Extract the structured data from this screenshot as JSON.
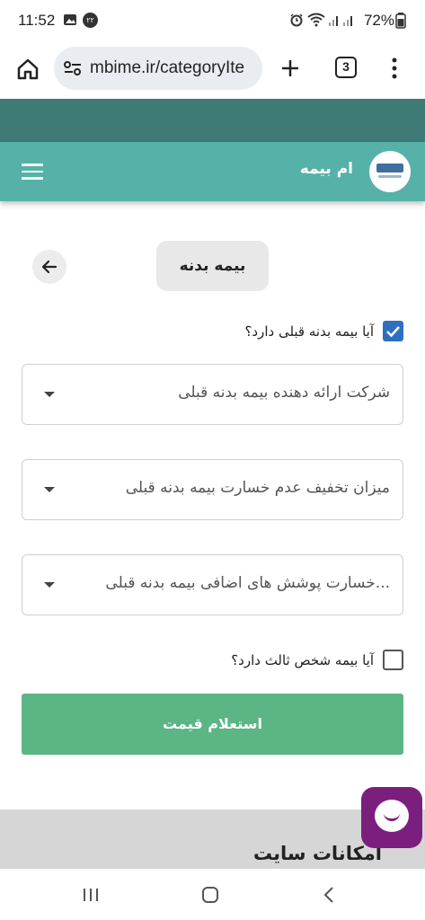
{
  "status_bar": {
    "time": "11:52",
    "notification_badge": "۲۲",
    "battery": "72%",
    "icons": [
      "gallery-icon",
      "notification-badge-icon",
      "alarm-icon",
      "wifi-icon",
      "signal-icon",
      "signal-icon",
      "battery-icon"
    ]
  },
  "browser": {
    "url": "mbime.ir/categoryIte",
    "tab_count": "3",
    "icons": [
      "home-icon",
      "site-settings-icon",
      "new-tab-icon",
      "more-icon"
    ]
  },
  "site_header": {
    "brand": "ام بیمه",
    "icons": [
      "menu-icon",
      "logo"
    ]
  },
  "page": {
    "title": "بیمه بدنه"
  },
  "form": {
    "has_previous_insurance": {
      "label": "آیا بیمه بدنه قبلی دارد؟",
      "checked": true
    },
    "select_company": {
      "placeholder": "شرکت ارائه دهنده بیمه بدنه قبلی"
    },
    "select_discount": {
      "placeholder": "میزان تخفیف عدم خسارت بیمه بدنه قبلی"
    },
    "select_additional": {
      "placeholder": "...خسارت پوشش های اضافی بیمه بدنه قبلی"
    },
    "has_third_party": {
      "label": "آیا بیمه شخص ثالث دارد؟",
      "checked": false
    },
    "submit_label": "استعلام قیمت"
  },
  "footer": {
    "title": "امکانات سایت"
  },
  "colors": {
    "header_dark": "#3e7b76",
    "header": "#56b2a8",
    "submit": "#5bb584",
    "checkbox": "#2f6fc2",
    "chat": "#7b1f7e"
  }
}
